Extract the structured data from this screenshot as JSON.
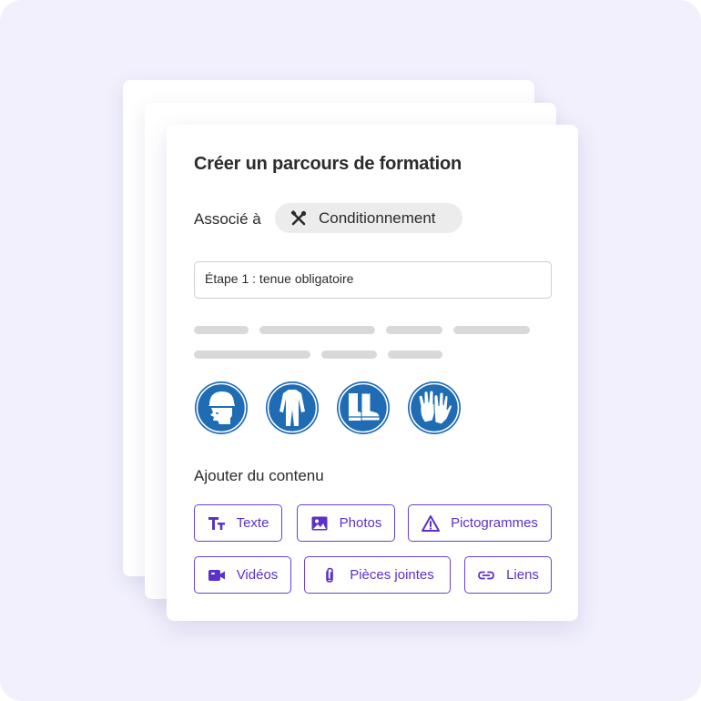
{
  "dialog": {
    "title": "Créer un parcours de formation",
    "associated_label": "Associé à",
    "associated_chip": {
      "label": "Conditionnement",
      "icon": "tools-icon"
    },
    "step_field": {
      "value": "Étape 1 : tenue obligatoire"
    },
    "pictograms": [
      {
        "name": "hard-hat-sign-icon"
      },
      {
        "name": "coverall-sign-icon"
      },
      {
        "name": "safety-boots-sign-icon"
      },
      {
        "name": "gloves-sign-icon"
      }
    ],
    "add_content_label": "Ajouter du contenu",
    "content_buttons": [
      {
        "label": "Texte",
        "icon": "text-icon"
      },
      {
        "label": "Photos",
        "icon": "image-icon"
      },
      {
        "label": "Pictogrammes",
        "icon": "warning-icon"
      },
      {
        "label": "Vidéos",
        "icon": "video-icon"
      },
      {
        "label": "Pièces jointes",
        "icon": "paperclip-icon"
      },
      {
        "label": "Liens",
        "icon": "link-icon"
      }
    ]
  },
  "colors": {
    "background": "#f1f0fc",
    "accent": "#5b31c9",
    "sign_blue": "#1f6cb5",
    "placeholder_bar": "#d9d9d9"
  }
}
